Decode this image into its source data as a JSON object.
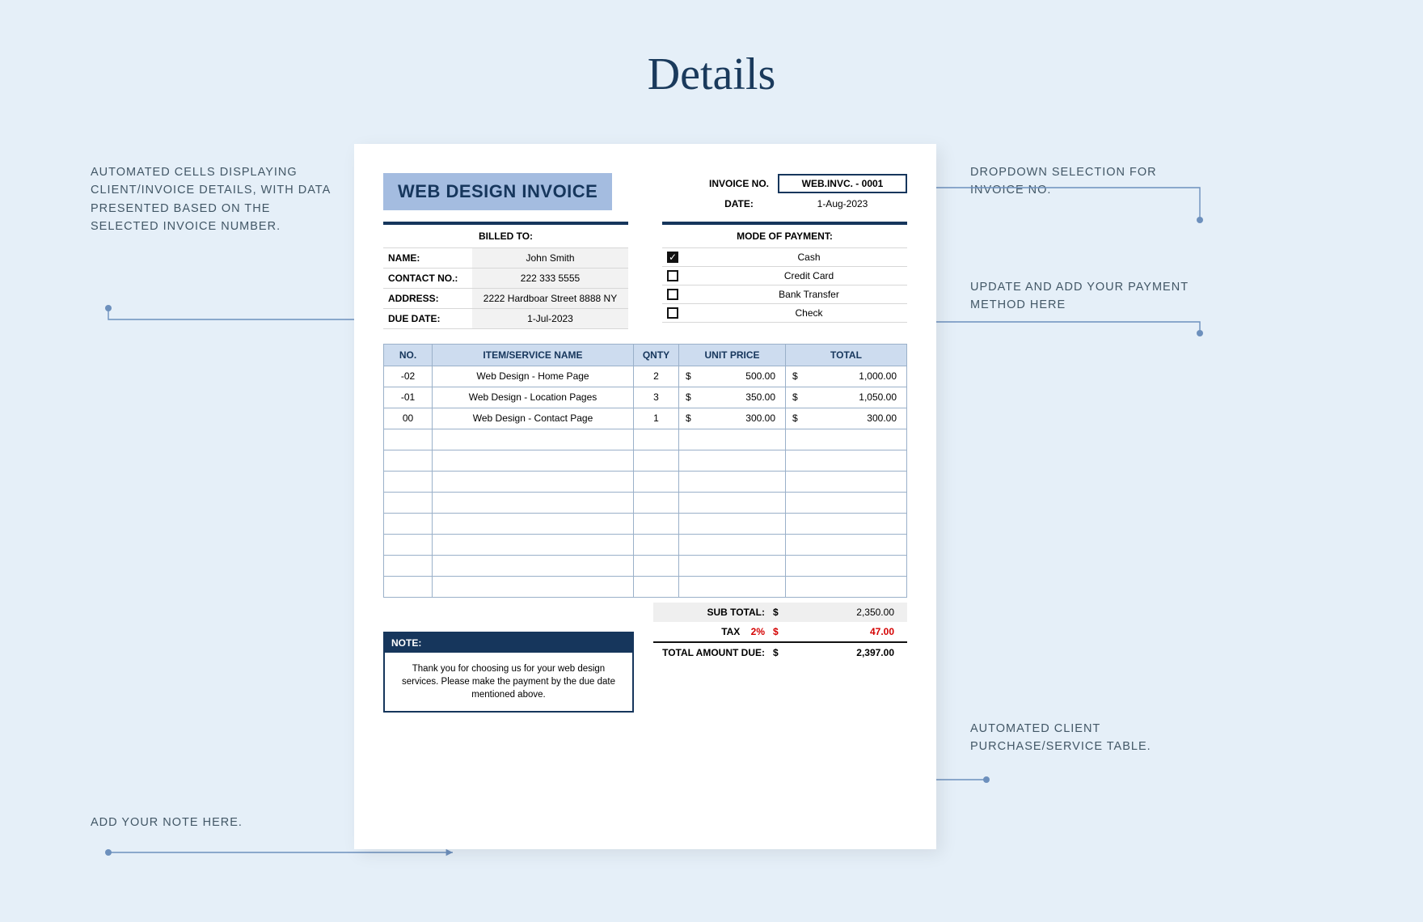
{
  "page": {
    "title": "Details"
  },
  "callouts": {
    "client_details": "AUTOMATED CELLS DISPLAYING CLIENT/INVOICE DETAILS, WITH DATA PRESENTED BASED ON THE SELECTED INVOICE NUMBER.",
    "invoice_dropdown": "DROPDOWN SELECTION FOR INVOICE NO.",
    "payment_method": "UPDATE AND ADD YOUR PAYMENT METHOD HERE",
    "auto_table": "AUTOMATED CLIENT PURCHASE/SERVICE TABLE.",
    "note_hint": "ADD YOUR NOTE HERE."
  },
  "invoice": {
    "title": "WEB DESIGN INVOICE",
    "meta": {
      "invoice_no_label": "INVOICE NO.",
      "invoice_no": "WEB.INVC. - 0001",
      "date_label": "DATE:",
      "date": "1-Aug-2023"
    },
    "billed": {
      "heading": "BILLED TO:",
      "name_label": "NAME:",
      "name": "John Smith",
      "contact_label": "CONTACT NO.:",
      "contact": "222 333 5555",
      "address_label": "ADDRESS:",
      "address": "2222 Hardboar Street 8888 NY",
      "due_label": "DUE DATE:",
      "due": "1-Jul-2023"
    },
    "payment": {
      "heading": "MODE OF PAYMENT:",
      "options": [
        {
          "label": "Cash",
          "checked": true
        },
        {
          "label": "Credit Card",
          "checked": false
        },
        {
          "label": "Bank Transfer",
          "checked": false
        },
        {
          "label": "Check",
          "checked": false
        }
      ]
    },
    "table": {
      "headers": {
        "no": "NO.",
        "item": "ITEM/SERVICE NAME",
        "qty": "QNTY",
        "price": "UNIT PRICE",
        "total": "TOTAL"
      },
      "rows": [
        {
          "no": "-02",
          "item": "Web Design - Home Page",
          "qty": "2",
          "price": "500.00",
          "total": "1,000.00"
        },
        {
          "no": "-01",
          "item": "Web Design - Location Pages",
          "qty": "3",
          "price": "350.00",
          "total": "1,050.00"
        },
        {
          "no": "00",
          "item": "Web Design - Contact Page",
          "qty": "1",
          "price": "300.00",
          "total": "300.00"
        }
      ],
      "empty_rows": 8,
      "currency": "$"
    },
    "totals": {
      "sub_label": "SUB TOTAL:",
      "sub": "2,350.00",
      "tax_label": "TAX",
      "tax_pct": "2%",
      "tax": "47.00",
      "grand_label": "TOTAL AMOUNT DUE:",
      "grand": "2,397.00"
    },
    "note": {
      "heading": "NOTE:",
      "body": "Thank you for choosing us for your web design services. Please make the payment by the due date mentioned above."
    }
  }
}
